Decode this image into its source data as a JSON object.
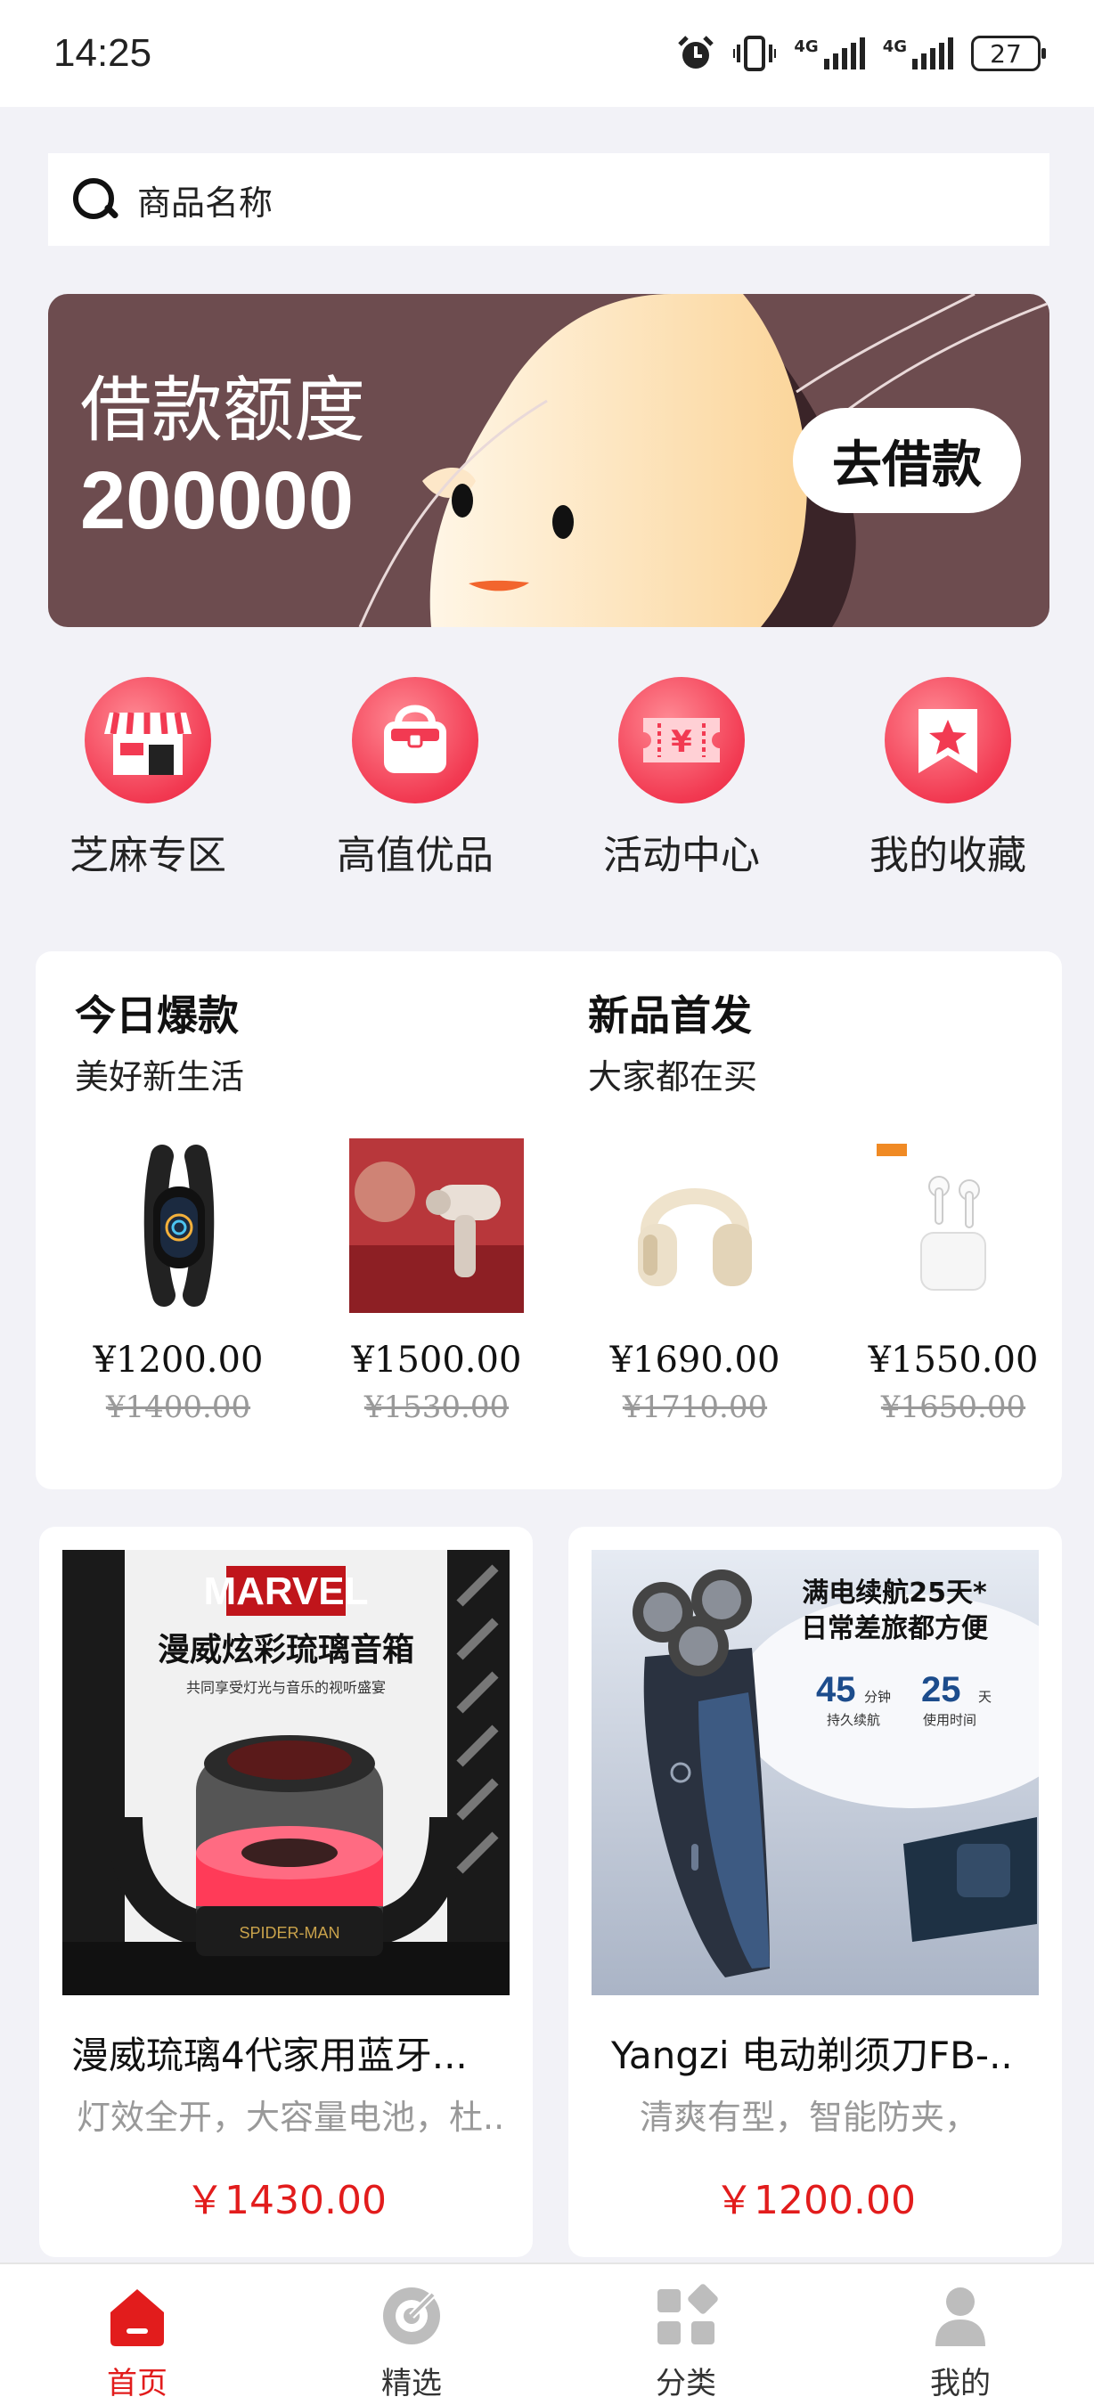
{
  "status_bar": {
    "time": "14:25",
    "network_1": "4G",
    "network_2": "4G",
    "battery": "27"
  },
  "search": {
    "placeholder": "商品名称"
  },
  "banner": {
    "title": "借款额度",
    "amount": "200000",
    "button": "去借款"
  },
  "quick_nav": [
    {
      "label": "芝麻专区",
      "icon": "store-icon"
    },
    {
      "label": "高值优品",
      "icon": "bag-icon"
    },
    {
      "label": "活动中心",
      "icon": "ticket-icon"
    },
    {
      "label": "我的收藏",
      "icon": "bookmark-star-icon"
    }
  ],
  "deals": {
    "hot": {
      "title": "今日爆款",
      "subtitle": "美好新生活"
    },
    "new": {
      "title": "新品首发",
      "subtitle": "大家都在买"
    },
    "items": [
      {
        "price": "¥1200.00",
        "old_price": "¥1400.00",
        "image": "smart-band"
      },
      {
        "price": "¥1500.00",
        "old_price": "¥1530.00",
        "image": "massage-gun"
      },
      {
        "price": "¥1690.00",
        "old_price": "¥1710.00",
        "image": "headphones"
      },
      {
        "price": "¥1550.00",
        "old_price": "¥1650.00",
        "image": "earbuds"
      }
    ]
  },
  "products": [
    {
      "name": "漫威琉璃4代家用蓝牙...",
      "desc": "灯效全开，大容量电池，杜..",
      "price": "￥1430.00",
      "img_brand": "MARVEL",
      "img_title": "漫威炫彩琉璃音箱",
      "img_sub": "共同享受灯光与音乐的视听盛宴",
      "img_label": "SPIDER-MAN"
    },
    {
      "name": "Yangzi 电动剃须刀FB-..",
      "desc": "清爽有型，智能防夹，",
      "price": "￥1200.00",
      "img_title_1": "满电续航25天*",
      "img_title_2": "日常差旅都方便",
      "stat_1_value": "45",
      "stat_1_unit": "分钟",
      "stat_1_label": "持久续航",
      "stat_2_value": "25",
      "stat_2_unit": "天",
      "stat_2_label": "使用时间"
    }
  ],
  "tabs": [
    {
      "label": "首页",
      "icon": "home-icon",
      "active": true
    },
    {
      "label": "精选",
      "icon": "compass-icon",
      "active": false
    },
    {
      "label": "分类",
      "icon": "category-icon",
      "active": false
    },
    {
      "label": "我的",
      "icon": "user-icon",
      "active": false
    }
  ],
  "colors": {
    "accent": "#e21c1c",
    "banner_bg": "#6d4c4f",
    "page_bg": "#f2f2f7"
  }
}
